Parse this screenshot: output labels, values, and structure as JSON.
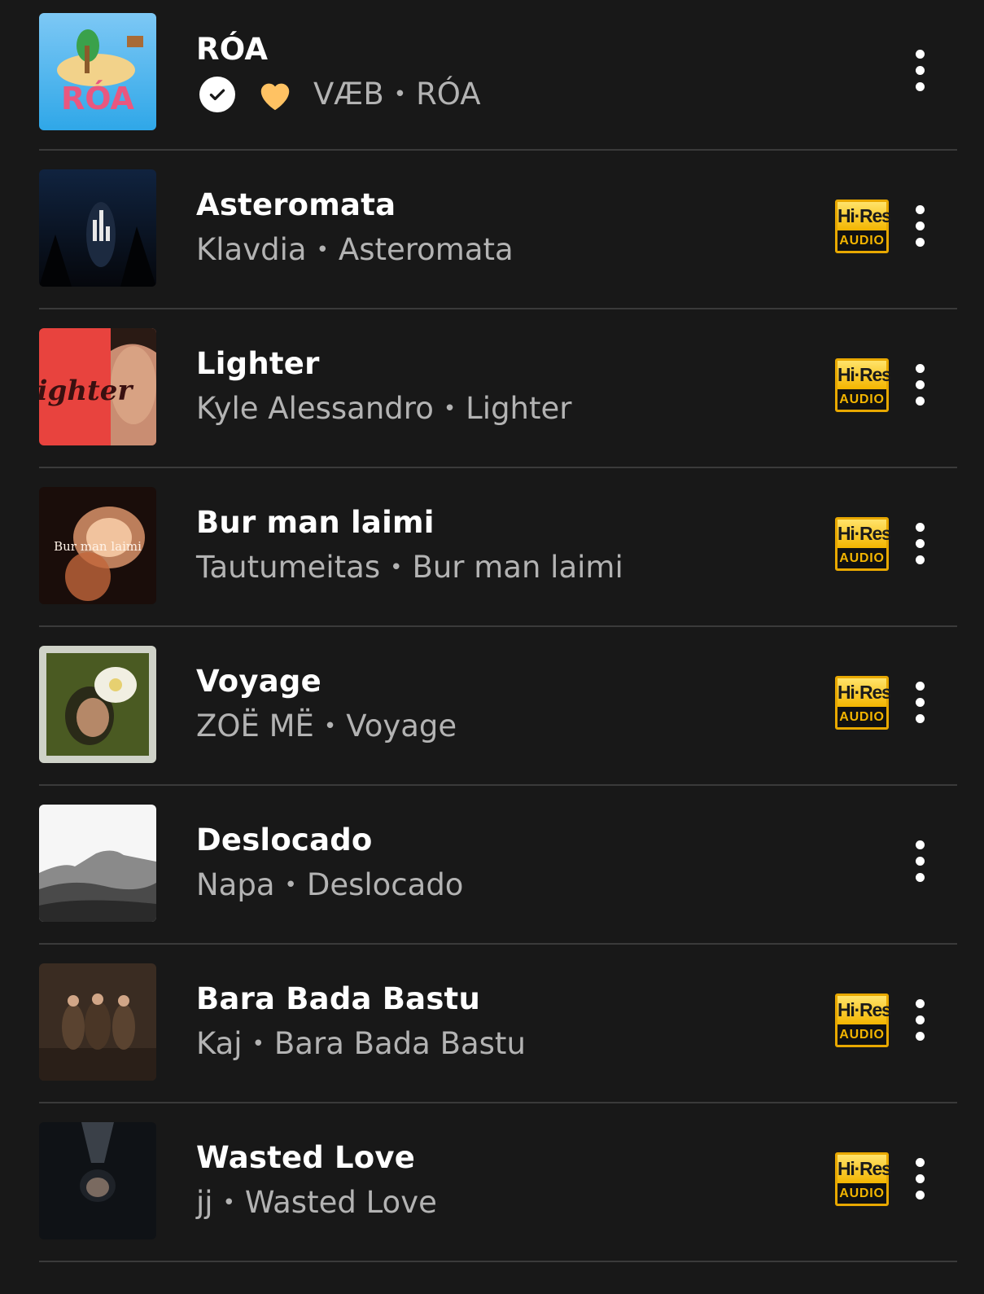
{
  "tracks": [
    {
      "title": "RÓA",
      "artist": "VÆB",
      "album": "RÓA",
      "downloaded": true,
      "liked": true,
      "hires": false
    },
    {
      "title": "Asteromata",
      "artist": "Klavdia",
      "album": "Asteromata",
      "hires": true
    },
    {
      "title": "Lighter",
      "artist": "Kyle Alessandro",
      "album": "Lighter",
      "hires": true
    },
    {
      "title": "Bur man laimi",
      "artist": "Tautumeitas",
      "album": "Bur man laimi",
      "hires": true
    },
    {
      "title": "Voyage",
      "artist": "ZOË MË",
      "album": "Voyage",
      "hires": true
    },
    {
      "title": "Deslocado",
      "artist": "Napa",
      "album": "Deslocado",
      "hires": false
    },
    {
      "title": "Bara Bada Bastu",
      "artist": "Kaj",
      "album": "Bara Bada Bastu",
      "hires": true
    },
    {
      "title": "Wasted Love",
      "artist": "jj",
      "album": "Wasted Love",
      "hires": true
    }
  ],
  "separator": "•",
  "badge": {
    "hires_top": "Hi·Res",
    "hires_bottom": "AUDIO"
  },
  "icons": {
    "downloaded": "check-circle-icon",
    "liked": "heart-icon",
    "more": "more-vertical-icon"
  },
  "colors": {
    "background": "#181818",
    "heart": "#ffc263",
    "hires_gold": "#f3b500",
    "secondary_text": "#b3b3b3"
  }
}
